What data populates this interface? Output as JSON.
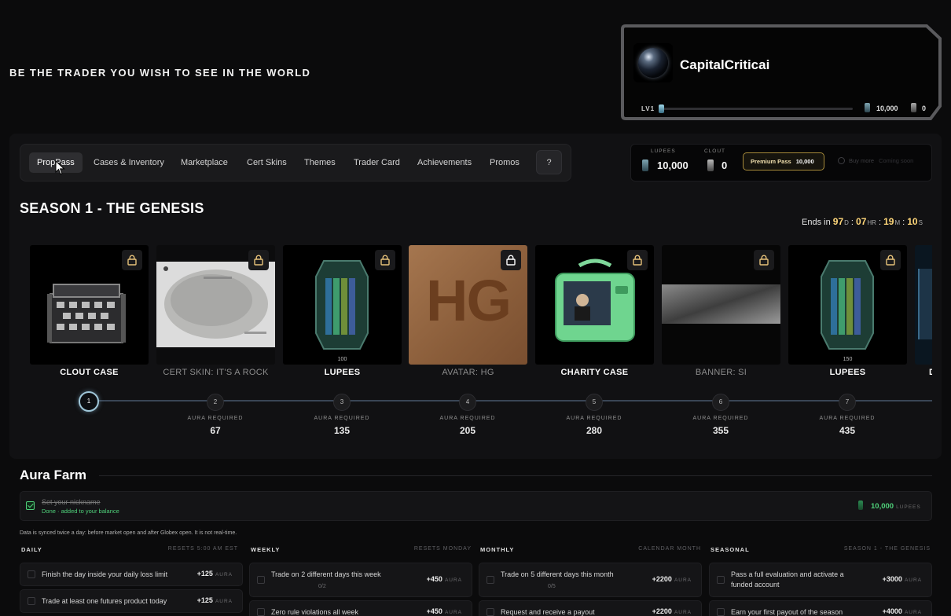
{
  "header": {
    "tagline": "BE THE TRADER YOU WISH TO SEE IN THE WORLD"
  },
  "profile": {
    "username": "CapitalCriticai",
    "level": "LV1",
    "level_progress_pct": 2,
    "lupees": "10,000",
    "clout": "0"
  },
  "nav": {
    "tabs": [
      {
        "label": "PropPass",
        "active": true
      },
      {
        "label": "Cases & Inventory"
      },
      {
        "label": "Marketplace"
      },
      {
        "label": "Cert Skins"
      },
      {
        "label": "Themes"
      },
      {
        "label": "Trader Card"
      },
      {
        "label": "Achievements"
      },
      {
        "label": "Promos"
      }
    ],
    "help_label": "?"
  },
  "wallet": {
    "lupees_label": "LUPEES",
    "lupees_value": "10,000",
    "clout_label": "CLOUT",
    "clout_value": "0",
    "premium_label": "Premium Pass",
    "premium_price": "10,000",
    "buy_more": "Buy more",
    "coming_soon": "Coming soon"
  },
  "season": {
    "title": "SEASON 1 - THE GENESIS",
    "ends_label": "Ends in",
    "days": "97",
    "days_unit": "D",
    "hours": "07",
    "hours_unit": "HR",
    "minutes": "19",
    "minutes_unit": "M",
    "seconds": "10",
    "seconds_unit": "S"
  },
  "rewards": [
    {
      "label": "CLOUT CASE",
      "dim": false,
      "locked": true,
      "icon": "case"
    },
    {
      "label": "CERT SKIN: IT'S A ROCK",
      "dim": true,
      "locked": true,
      "icon": "rock-cert"
    },
    {
      "label": "LUPEES",
      "dim": false,
      "locked": true,
      "icon": "lupee-crystal",
      "qty": "100"
    },
    {
      "label": "AVATAR: HG",
      "dim": true,
      "locked": true,
      "icon": "avatar-hg",
      "avatar_text": "HG"
    },
    {
      "label": "CHARITY CASE",
      "dim": false,
      "locked": true,
      "icon": "charity-case"
    },
    {
      "label": "BANNER: SI",
      "dim": true,
      "locked": true,
      "icon": "banner"
    },
    {
      "label": "LUPEES",
      "dim": false,
      "locked": true,
      "icon": "lupee-crystal",
      "qty": "150"
    },
    {
      "label": "D",
      "dim": false,
      "locked": false,
      "icon": "partial"
    }
  ],
  "progress": {
    "aura_label": "AURA REQUIRED",
    "nodes": [
      {
        "num": "1",
        "aura": ""
      },
      {
        "num": "2",
        "aura": "67"
      },
      {
        "num": "3",
        "aura": "135"
      },
      {
        "num": "4",
        "aura": "205"
      },
      {
        "num": "5",
        "aura": "280"
      },
      {
        "num": "6",
        "aura": "355"
      },
      {
        "num": "7",
        "aura": "435"
      }
    ]
  },
  "aura_farm": {
    "title": "Aura Farm",
    "completed": {
      "name": "Set your nickname",
      "status": "Done · added to your balance",
      "reward": "10,000",
      "unit": "LUPEES"
    },
    "sync_note": "Data is synced twice a day: before market open and after Globex open. It is not real-time.",
    "columns": [
      {
        "title": "DAILY",
        "reset": "RESETS 5:00 AM EST",
        "tasks": [
          {
            "name": "Finish the day inside your daily loss limit",
            "reward": "+125",
            "unit": "AURA"
          },
          {
            "name": "Trade at least one futures product today",
            "reward": "+125",
            "unit": "AURA"
          }
        ]
      },
      {
        "title": "WEEKLY",
        "reset": "RESETS MONDAY",
        "tasks": [
          {
            "name": "Trade on 2 different days this week",
            "progress": "0/2",
            "reward": "+450",
            "unit": "AURA"
          },
          {
            "name": "Zero rule violations all week",
            "reward": "+450",
            "unit": "AURA"
          }
        ]
      },
      {
        "title": "MONTHLY",
        "reset": "CALENDAR MONTH",
        "tasks": [
          {
            "name": "Trade on 5 different days this month",
            "progress": "0/5",
            "reward": "+2200",
            "unit": "AURA"
          },
          {
            "name": "Request and receive a payout",
            "reward": "+2200",
            "unit": "AURA"
          }
        ]
      },
      {
        "title": "SEASONAL",
        "reset": "SEASON 1 - THE GENESIS",
        "tasks": [
          {
            "name": "Pass a full evaluation and activate a funded account",
            "reward": "+3000",
            "unit": "AURA"
          },
          {
            "name": "Earn your first payout of the season",
            "reward": "+4000",
            "unit": "AURA"
          }
        ]
      }
    ]
  }
}
